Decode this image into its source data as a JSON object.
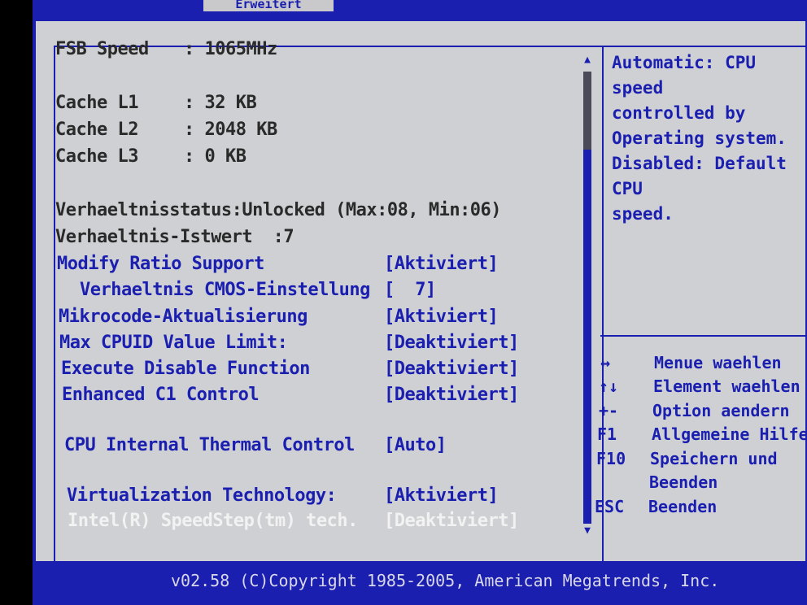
{
  "header": {
    "tab_label": "Erweitert"
  },
  "settings": {
    "fsb": {
      "label": "FSB Speed",
      "value": ": 1065MHz"
    },
    "cache_l1": {
      "label": "Cache L1",
      "value": ": 32 KB"
    },
    "cache_l2": {
      "label": "Cache L2",
      "value": ": 2048 KB"
    },
    "cache_l3": {
      "label": "Cache L3",
      "value": ": 0 KB"
    },
    "ratio_status": {
      "label": "Verhaeltnisstatus:Unlocked (Max:08, Min:06)"
    },
    "ratio_actual": {
      "label": "Verhaeltnis-Istwert  :7"
    },
    "modify_ratio": {
      "label": "Modify Ratio Support",
      "value": "[Aktiviert]"
    },
    "ratio_cmos": {
      "label": "Verhaeltnis CMOS-Einstellung",
      "value": "[  7]"
    },
    "microcode": {
      "label": "Mikrocode-Aktualisierung",
      "value": "[Aktiviert]"
    },
    "max_cpuid": {
      "label": "Max CPUID Value Limit:",
      "value": "[Deaktiviert]"
    },
    "execute_disable": {
      "label": "Execute Disable Function",
      "value": "[Deaktiviert]"
    },
    "enhanced_c1": {
      "label": "Enhanced C1 Control",
      "value": "[Deaktiviert]"
    },
    "thermal_control": {
      "label": "CPU Internal Thermal Control",
      "value": "[Auto]"
    },
    "virtualization": {
      "label": "Virtualization Technology:",
      "value": "[Aktiviert]"
    },
    "speedstep": {
      "label": "Intel(R) SpeedStep(tm) tech.",
      "value": "[Deaktiviert]"
    }
  },
  "help": {
    "text": "Automatic: CPU speed\ncontrolled by\nOperating system.\nDisabled: Default CPU\nspeed."
  },
  "keys": [
    {
      "key": "↔",
      "desc": "Menue waehlen"
    },
    {
      "key": "↑↓",
      "desc": "Element waehlen"
    },
    {
      "key": "+-",
      "desc": "Option aendern"
    },
    {
      "key": "F1",
      "desc": "Allgemeine Hilfe"
    },
    {
      "key": "F10",
      "desc": "Speichern und"
    },
    {
      "key": "",
      "desc": "Beenden"
    },
    {
      "key": "ESC",
      "desc": "Beenden"
    }
  ],
  "scroll": {
    "up_icon": "▲",
    "down_icon": "▼"
  },
  "footer": {
    "text": "v02.58 (C)Copyright 1985-2005, American Megatrends, Inc."
  },
  "colors": {
    "bios_blue": "#1b1fb0",
    "panel_gray": "#cfd0d3",
    "info_text": "#2a2a2a",
    "disabled_text": "#f2f2f2"
  }
}
